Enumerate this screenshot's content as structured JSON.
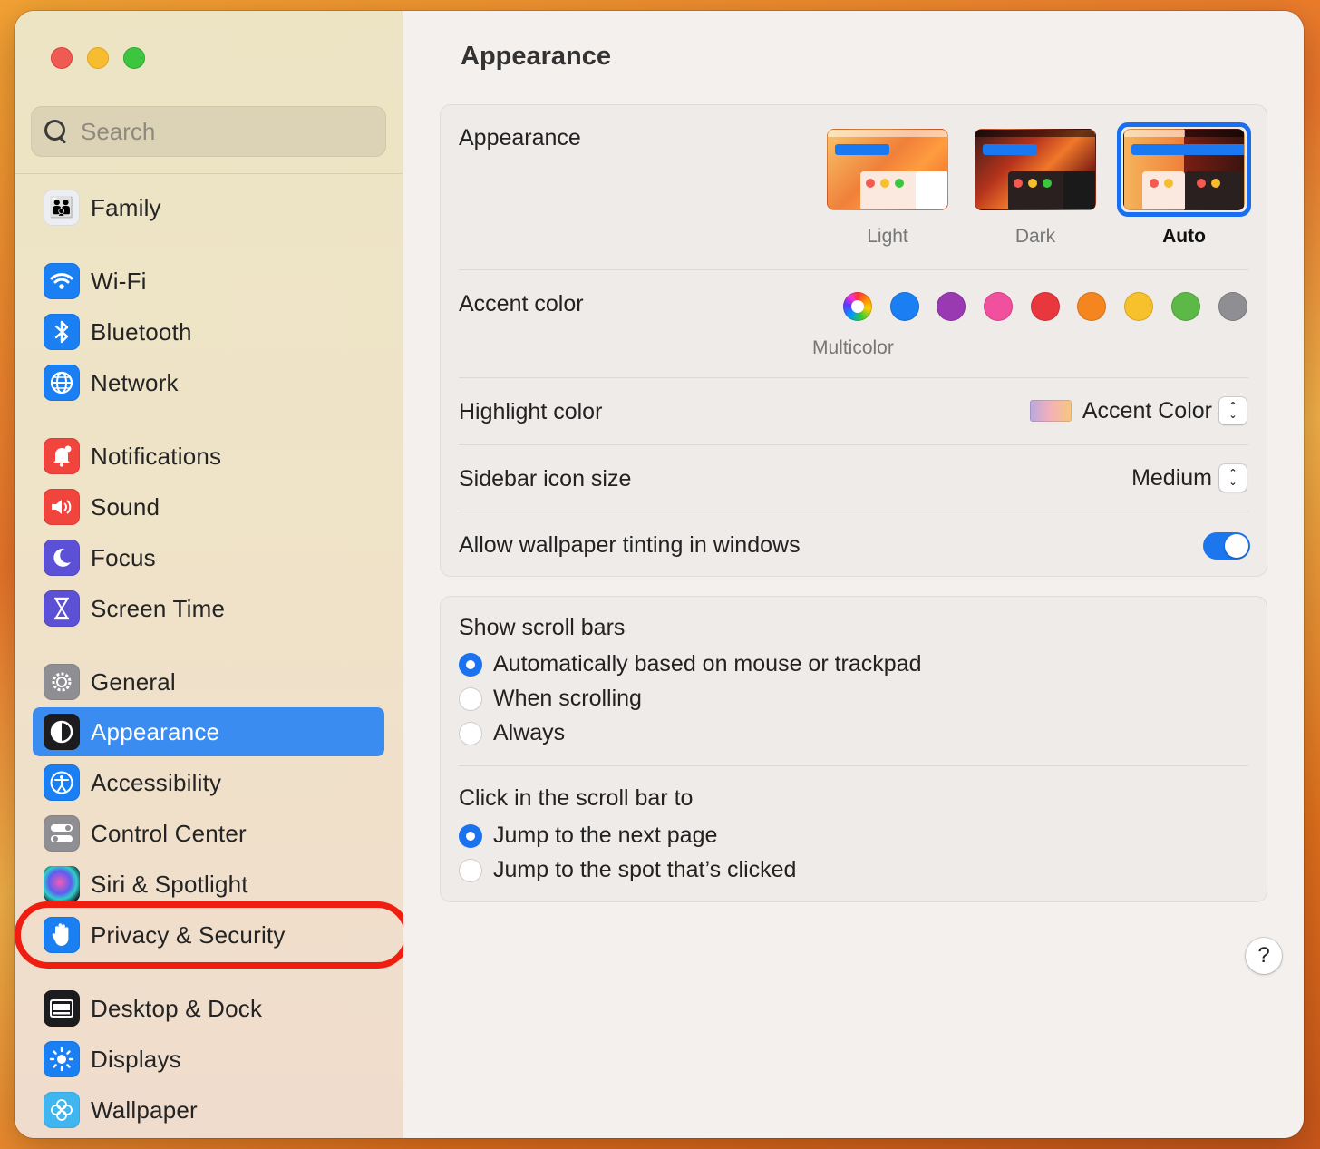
{
  "window": {
    "title": "Appearance"
  },
  "search": {
    "placeholder": "Search",
    "value": ""
  },
  "sidebar": {
    "items": [
      {
        "label": "Family",
        "icon": "family-icon",
        "color": "#e9e9ee"
      },
      {
        "label": "Wi-Fi",
        "icon": "wifi-icon",
        "color": "#1a7ff2"
      },
      {
        "label": "Bluetooth",
        "icon": "bluetooth-icon",
        "color": "#1a7ff2"
      },
      {
        "label": "Network",
        "icon": "network-icon",
        "color": "#1a7ff2"
      },
      {
        "label": "Notifications",
        "icon": "notifications-icon",
        "color": "#f0443c"
      },
      {
        "label": "Sound",
        "icon": "sound-icon",
        "color": "#f0443c"
      },
      {
        "label": "Focus",
        "icon": "focus-icon",
        "color": "#5b50d6"
      },
      {
        "label": "Screen Time",
        "icon": "screen-time-icon",
        "color": "#5b50d6"
      },
      {
        "label": "General",
        "icon": "general-icon",
        "color": "#8e8e93"
      },
      {
        "label": "Appearance",
        "icon": "appearance-icon",
        "color": "#1c1c1e",
        "selected": true
      },
      {
        "label": "Accessibility",
        "icon": "accessibility-icon",
        "color": "#1a7ff2"
      },
      {
        "label": "Control Center",
        "icon": "control-center-icon",
        "color": "#8e8e93"
      },
      {
        "label": "Siri & Spotlight",
        "icon": "siri-icon",
        "color": "#2b2b3a"
      },
      {
        "label": "Privacy & Security",
        "icon": "privacy-hand-icon",
        "color": "#1a7ff2",
        "highlighted": true
      },
      {
        "label": "Desktop & Dock",
        "icon": "desktop-dock-icon",
        "color": "#1c1c1e"
      },
      {
        "label": "Displays",
        "icon": "displays-icon",
        "color": "#1a7ff2"
      },
      {
        "label": "Wallpaper",
        "icon": "wallpaper-icon",
        "color": "#3fb6f0"
      }
    ]
  },
  "main": {
    "title": "Appearance",
    "appearance": {
      "label": "Appearance",
      "options": [
        {
          "label": "Light",
          "selected": false
        },
        {
          "label": "Dark",
          "selected": false
        },
        {
          "label": "Auto",
          "selected": true
        }
      ]
    },
    "accent": {
      "label": "Accent color",
      "caption": "Multicolor",
      "colors": [
        "multicolor",
        "#1a7ff2",
        "#9a3ab2",
        "#f0509e",
        "#e8383d",
        "#f5861f",
        "#f7c12d",
        "#5cb947",
        "#8e8e93"
      ]
    },
    "highlight": {
      "label": "Highlight color",
      "value": "Accent Color"
    },
    "sidebar_icon_size": {
      "label": "Sidebar icon size",
      "value": "Medium"
    },
    "wallpaper_tinting": {
      "label": "Allow wallpaper tinting in windows",
      "on": true
    },
    "scroll_bars": {
      "label": "Show scroll bars",
      "options": [
        {
          "label": "Automatically based on mouse or trackpad",
          "selected": true
        },
        {
          "label": "When scrolling",
          "selected": false
        },
        {
          "label": "Always",
          "selected": false
        }
      ]
    },
    "click_scroll": {
      "label": "Click in the scroll bar to",
      "options": [
        {
          "label": "Jump to the next page",
          "selected": true
        },
        {
          "label": "Jump to the spot that’s clicked",
          "selected": false
        }
      ]
    },
    "help": "?"
  },
  "stepper_glyphs": {
    "up": "⌃",
    "down": "⌄"
  },
  "icon_glyphs": {
    "family": "👪",
    "wifi": "◠",
    "bluetooth": "ᛒ",
    "network": "◍",
    "notifications": "🔔",
    "sound": "🔊",
    "focus": "☾",
    "screen_time": "⌛",
    "general": "⚙",
    "appearance": "◐",
    "accessibility": "♿",
    "control_center": "☰",
    "siri": "◉",
    "privacy": "✋",
    "desktop": "▭",
    "displays": "☀",
    "wallpaper": "❀"
  }
}
